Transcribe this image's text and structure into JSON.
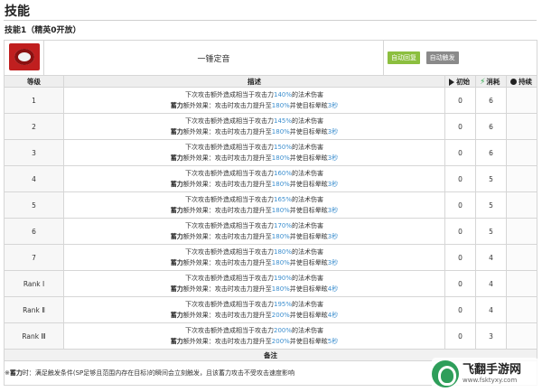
{
  "page": {
    "title": "技能",
    "subtitle": "技能1（精英0开放）"
  },
  "skill": {
    "name": "一锤定音",
    "tags": [
      "自动回复",
      "自动触发"
    ]
  },
  "columns": {
    "level": "等级",
    "desc": "描述",
    "initial": "初始",
    "cost": "消耗",
    "duration": "持续"
  },
  "desc_parts": {
    "l1_pre": "下次攻击额外造成相当于攻击力",
    "l1_post": "的法术伤害",
    "l2_prefix": "蓄力",
    "l2_mid": "额外效果：攻击时攻击力提升至",
    "l2_post": "并使目标晕眩"
  },
  "rows": [
    {
      "level": "1",
      "dmg": "140%",
      "atk": "180%",
      "stun": "3秒",
      "initial": "0",
      "cost": "6",
      "duration": ""
    },
    {
      "level": "2",
      "dmg": "145%",
      "atk": "180%",
      "stun": "3秒",
      "initial": "0",
      "cost": "6",
      "duration": ""
    },
    {
      "level": "3",
      "dmg": "150%",
      "atk": "180%",
      "stun": "3秒",
      "initial": "0",
      "cost": "6",
      "duration": ""
    },
    {
      "level": "4",
      "dmg": "160%",
      "atk": "180%",
      "stun": "3秒",
      "initial": "0",
      "cost": "5",
      "duration": ""
    },
    {
      "level": "5",
      "dmg": "165%",
      "atk": "180%",
      "stun": "3秒",
      "initial": "0",
      "cost": "5",
      "duration": ""
    },
    {
      "level": "6",
      "dmg": "170%",
      "atk": "180%",
      "stun": "3秒",
      "initial": "0",
      "cost": "5",
      "duration": ""
    },
    {
      "level": "7",
      "dmg": "180%",
      "atk": "180%",
      "stun": "3秒",
      "initial": "0",
      "cost": "4",
      "duration": ""
    },
    {
      "level": "Rank Ⅰ",
      "dmg": "190%",
      "atk": "180%",
      "stun": "4秒",
      "initial": "0",
      "cost": "4",
      "duration": ""
    },
    {
      "level": "Rank Ⅱ",
      "dmg": "195%",
      "atk": "200%",
      "stun": "4秒",
      "initial": "0",
      "cost": "4",
      "duration": ""
    },
    {
      "level": "Rank Ⅲ",
      "dmg": "200%",
      "atk": "200%",
      "stun": "5秒",
      "initial": "0",
      "cost": "3",
      "duration": ""
    }
  ],
  "notes": {
    "header": "备注",
    "prefix": "※",
    "strong": "蓄力",
    "text": "时：满足触发条件(SP足够且范围内存在目标)的瞬间会立刻触发，且该蓄力攻击不受攻击速度影响"
  },
  "watermark": {
    "title": "飞翻手游网",
    "url": "www.fsktyxy.com"
  },
  "colors": {
    "highlight": "#3d8fcf",
    "tag_green": "#8cbf3f",
    "tag_gray": "#8a8a8a",
    "icon_red": "#c01f1f"
  }
}
